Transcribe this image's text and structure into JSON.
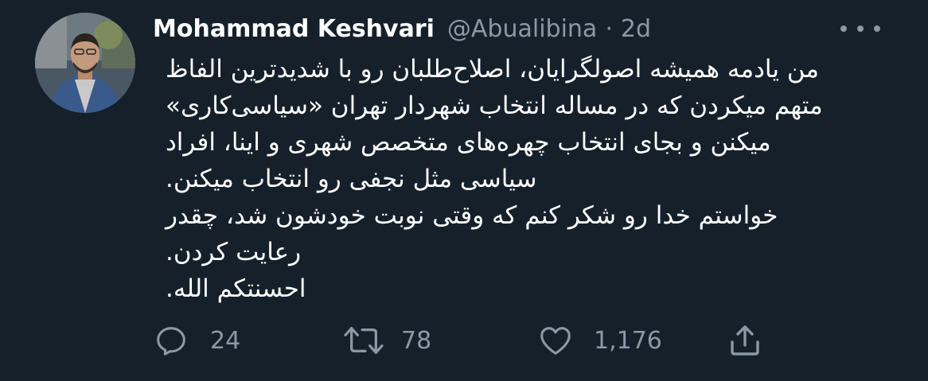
{
  "tweet": {
    "author_name": "Mohammad Keshvari",
    "handle": "@Abualibina",
    "separator": "·",
    "time": "2d",
    "body_lines": [
      "من یادمه همیشه اصولگرایان، اصلاح‌طلبان رو با شدیدترین الفاظ",
      "متهم میکردن که در مساله انتخاب شهردار تهران «سیاسی‌کاری»",
      "میکنن و بجای انتخاب چهره‌های متخصص شهری و اینا، افراد",
      "سیاسی مثل نجفی رو انتخاب میکنن.",
      "خواستم خدا رو شکر کنم که وقتی نوبت خودشون شد، چقدر",
      "رعایت کردن.",
      "احسنتکم الله."
    ],
    "actions": {
      "replies": "24",
      "retweets": "78",
      "likes": "1,176"
    }
  },
  "icons": {
    "reply": "reply-icon",
    "retweet": "retweet-icon",
    "like": "heart-icon",
    "share": "share-icon",
    "more": "more-icon"
  },
  "colors": {
    "background": "#15202b",
    "primary_text": "#ffffff",
    "secondary_text": "#8b98a5"
  }
}
